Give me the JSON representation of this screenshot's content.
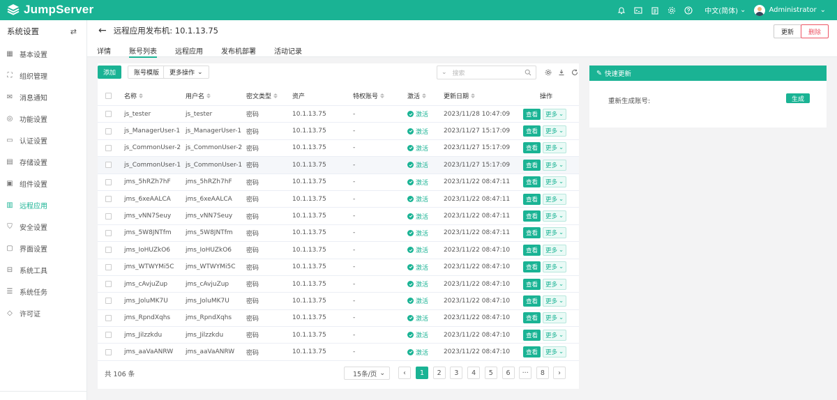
{
  "topbar": {
    "app_name": "JumpServer",
    "language": "中文(简体)",
    "username": "Administrator",
    "icons": [
      "bell-icon",
      "terminal-icon",
      "clipboard-icon",
      "gear-icon",
      "help-icon"
    ]
  },
  "sidebar": {
    "title": "系统设置",
    "items": [
      {
        "label": "基本设置",
        "icon": "grid-icon"
      },
      {
        "label": "组织管理",
        "icon": "org-icon"
      },
      {
        "label": "消息通知",
        "icon": "message-icon"
      },
      {
        "label": "功能设置",
        "icon": "feature-icon"
      },
      {
        "label": "认证设置",
        "icon": "id-card-icon"
      },
      {
        "label": "存储设置",
        "icon": "storage-icon"
      },
      {
        "label": "组件设置",
        "icon": "component-icon"
      },
      {
        "label": "远程应用",
        "icon": "app-icon",
        "active": true
      },
      {
        "label": "安全设置",
        "icon": "shield-icon"
      },
      {
        "label": "界面设置",
        "icon": "window-icon"
      },
      {
        "label": "系统工具",
        "icon": "toolbox-icon"
      },
      {
        "label": "系统任务",
        "icon": "task-icon"
      },
      {
        "label": "许可证",
        "icon": "license-icon"
      }
    ]
  },
  "header": {
    "title": "远程应用发布机: 10.1.13.75",
    "tabs": [
      "详情",
      "账号列表",
      "远程应用",
      "发布机部署",
      "活动记录"
    ],
    "active_tab": "账号列表",
    "update_label": "更新",
    "delete_label": "删除"
  },
  "toolbar": {
    "add_label": "添加",
    "template_label": "账号模版",
    "more_actions_label": "更多操作",
    "search_placeholder": "搜索"
  },
  "table": {
    "columns": [
      "名称",
      "用户名",
      "密文类型",
      "资产",
      "特权账号",
      "激活",
      "更新日期",
      "操作"
    ],
    "view_label": "查看",
    "more_label": "更多",
    "rows": [
      {
        "name": "js_tester",
        "username": "js_tester",
        "secret_type": "密码",
        "asset": "10.1.13.75",
        "privileged": "-",
        "active": "激活",
        "updated": "2023/11/28 10:47:09"
      },
      {
        "name": "js_ManagerUser-1",
        "username": "js_ManagerUser-1",
        "secret_type": "密码",
        "asset": "10.1.13.75",
        "privileged": "-",
        "active": "激活",
        "updated": "2023/11/27 15:17:09"
      },
      {
        "name": "js_CommonUser-2",
        "username": "js_CommonUser-2",
        "secret_type": "密码",
        "asset": "10.1.13.75",
        "privileged": "-",
        "active": "激活",
        "updated": "2023/11/27 15:17:09"
      },
      {
        "name": "js_CommonUser-1",
        "username": "js_CommonUser-1",
        "secret_type": "密码",
        "asset": "10.1.13.75",
        "privileged": "-",
        "active": "激活",
        "updated": "2023/11/27 15:17:09"
      },
      {
        "name": "jms_5hRZh7hF",
        "username": "jms_5hRZh7hF",
        "secret_type": "密码",
        "asset": "10.1.13.75",
        "privileged": "-",
        "active": "激活",
        "updated": "2023/11/22 08:47:11"
      },
      {
        "name": "jms_6xeAALCA",
        "username": "jms_6xeAALCA",
        "secret_type": "密码",
        "asset": "10.1.13.75",
        "privileged": "-",
        "active": "激活",
        "updated": "2023/11/22 08:47:11"
      },
      {
        "name": "jms_vNN7Seuy",
        "username": "jms_vNN7Seuy",
        "secret_type": "密码",
        "asset": "10.1.13.75",
        "privileged": "-",
        "active": "激活",
        "updated": "2023/11/22 08:47:11"
      },
      {
        "name": "jms_5W8JNTfm",
        "username": "jms_5W8JNTfm",
        "secret_type": "密码",
        "asset": "10.1.13.75",
        "privileged": "-",
        "active": "激活",
        "updated": "2023/11/22 08:47:11"
      },
      {
        "name": "jms_IoHUZkO6",
        "username": "jms_IoHUZkO6",
        "secret_type": "密码",
        "asset": "10.1.13.75",
        "privileged": "-",
        "active": "激活",
        "updated": "2023/11/22 08:47:10"
      },
      {
        "name": "jms_WTWYMi5C",
        "username": "jms_WTWYMi5C",
        "secret_type": "密码",
        "asset": "10.1.13.75",
        "privileged": "-",
        "active": "激活",
        "updated": "2023/11/22 08:47:10"
      },
      {
        "name": "jms_cAvjuZup",
        "username": "jms_cAvjuZup",
        "secret_type": "密码",
        "asset": "10.1.13.75",
        "privileged": "-",
        "active": "激活",
        "updated": "2023/11/22 08:47:10"
      },
      {
        "name": "jms_JoluMK7U",
        "username": "jms_JoluMK7U",
        "secret_type": "密码",
        "asset": "10.1.13.75",
        "privileged": "-",
        "active": "激活",
        "updated": "2023/11/22 08:47:10"
      },
      {
        "name": "jms_RpndXqhs",
        "username": "jms_RpndXqhs",
        "secret_type": "密码",
        "asset": "10.1.13.75",
        "privileged": "-",
        "active": "激活",
        "updated": "2023/11/22 08:47:10"
      },
      {
        "name": "jms_Jilzzkdu",
        "username": "jms_Jilzzkdu",
        "secret_type": "密码",
        "asset": "10.1.13.75",
        "privileged": "-",
        "active": "激活",
        "updated": "2023/11/22 08:47:10"
      },
      {
        "name": "jms_aaVaANRW",
        "username": "jms_aaVaANRW",
        "secret_type": "密码",
        "asset": "10.1.13.75",
        "privileged": "-",
        "active": "激活",
        "updated": "2023/11/22 08:47:10"
      }
    ]
  },
  "pagination": {
    "total": "共 106 条",
    "page_size": "15条/页",
    "pages": [
      "1",
      "2",
      "3",
      "4",
      "5",
      "6",
      "···",
      "8"
    ],
    "current": "1"
  },
  "quick_update": {
    "title": "快速更新",
    "label": "重新生成账号:",
    "button": "生成"
  },
  "colors": {
    "accent": "#1ab394",
    "danger": "#ed5565"
  }
}
